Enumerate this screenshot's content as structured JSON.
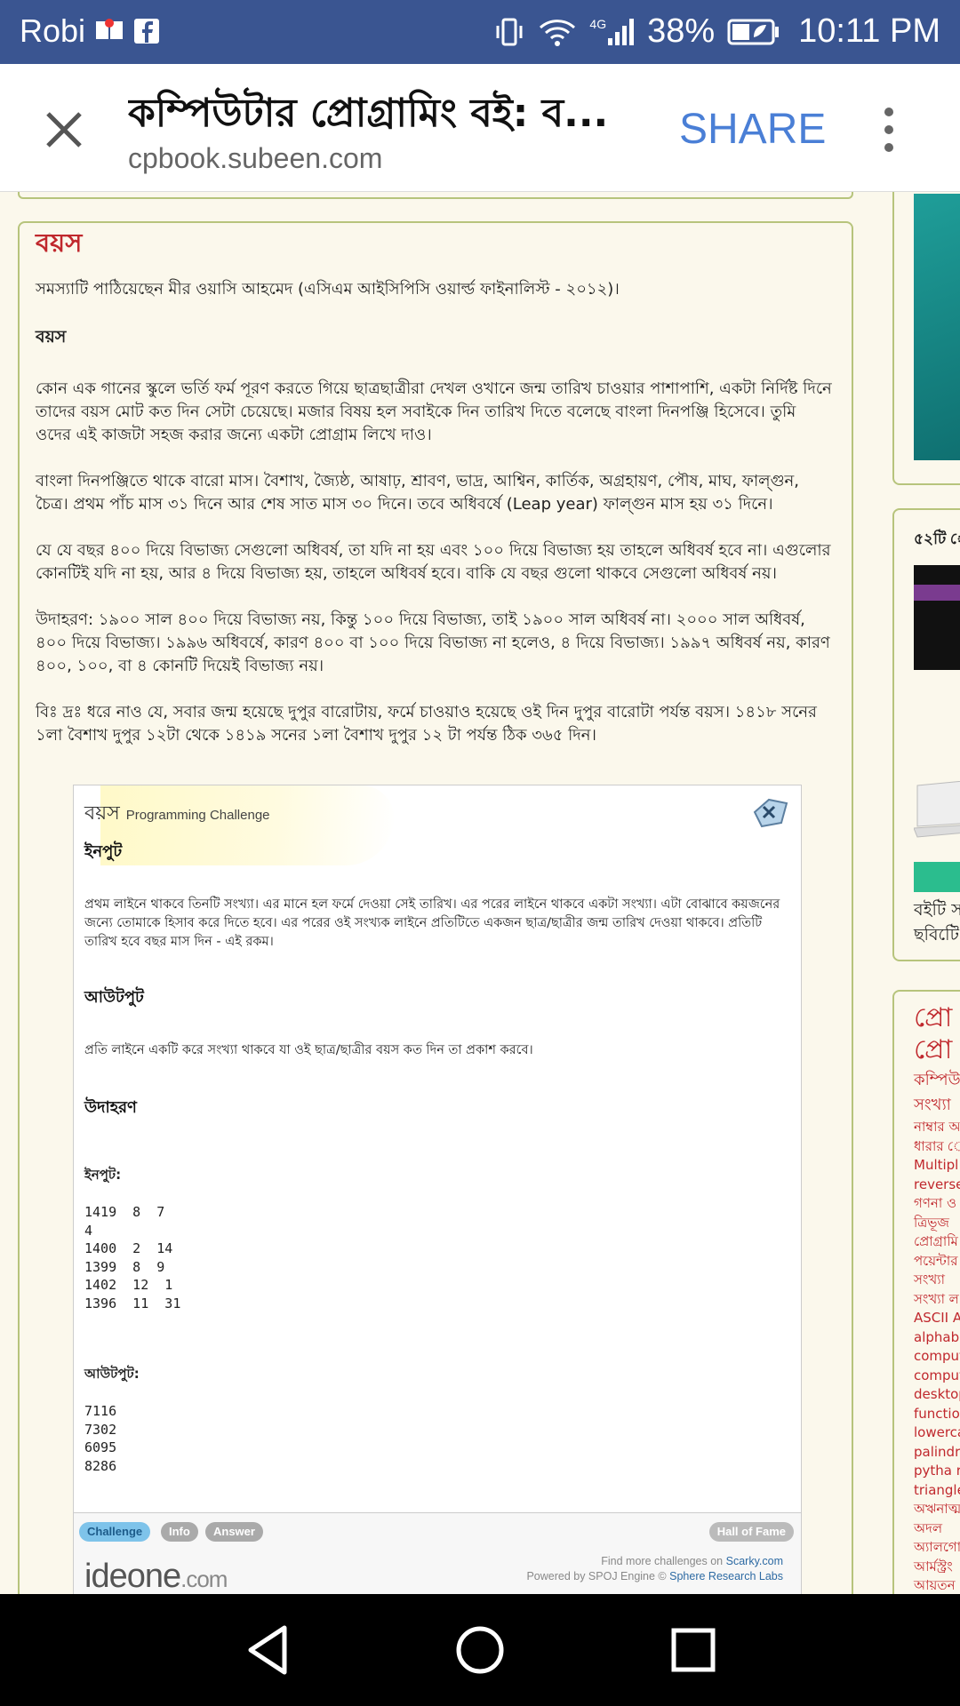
{
  "status_bar": {
    "carrier": "Robi",
    "battery": "38%",
    "network": "4G",
    "time": "10:11 PM"
  },
  "toolbar": {
    "title": "কম্পিউটার প্রোগ্রামিং বই: ব...",
    "url": "cpbook.subeen.com",
    "share": "SHARE"
  },
  "article": {
    "title": "বয়স",
    "intro": "সমস্যাটি পাঠিয়েছেন মীর ওয়াসি আহমেদ (এসিএম আইসিপিসি ওয়ার্ল্ড ফাইনালিস্ট - ২০১২)।",
    "subtitle": "বয়স",
    "p1": "কোন এক গানের স্কুলে ভর্তি ফর্ম পূরণ করতে গিয়ে ছাত্রছাত্রীরা দেখল ওখানে জন্ম তারিখ চাওয়ার পাশাপাশি, একটা নির্দিষ্ট দিনে তাদের বয়স মোট কত দিন সেটা চেয়েছে। মজার বিষয় হল সবাইকে দিন তারিখ দিতে বলেছে বাংলা দিনপঞ্জি হিসেবে। তুমি ওদের এই কাজটা সহজ করার জন্যে একটা প্রোগ্রাম লিখে দাও।",
    "p2": "বাংলা দিনপঞ্জিতে থাকে বারো মাস। বৈশাখ, জ্যৈষ্ঠ, আষাঢ়, শ্রাবণ, ভাদ্র, আশ্বিন, কার্তিক, অগ্রহায়ণ, পৌষ, মাঘ, ফাল্গুন, চৈত্র। প্রথম পাঁচ মাস ৩১ দিনে আর শেষ সাত মাস ৩০ দিনে। তবে অধিবর্ষে (Leap year) ফাল্গুন মাস হয় ৩১ দিনে।",
    "p3": "যে যে বছর ৪০০ দিয়ে বিভাজ্য সেগুলো অধিবর্ষ, তা যদি না হয় এবং ১০০ দিয়ে বিভাজ্য হয় তাহলে অধিবর্ষ হবে না। এগুলোর কোনটিই যদি না হয়, আর ৪ দিয়ে বিভাজ্য হয়, তাহলে অধিবর্ষ হবে। বাকি যে বছর গুলো থাকবে সেগুলো অধিবর্ষ নয়।",
    "p4": "উদাহরণ: ১৯০০ সাল ৪০০ দিয়ে বিভাজ্য নয়, কিন্তু ১০০ দিয়ে বিভাজ্য, তাই ১৯০০ সাল অধিবর্ষ না। ২০০০ সাল অধিবর্ষ, ৪০০ দিয়ে বিভাজ্য। ১৯৯৬ অধিবর্ষে, কারণ ৪০০ বা ১০০ দিয়ে বিভাজ্য না হলেও, ৪ দিয়ে বিভাজ্য। ১৯৯৭ অধিবর্ষ নয়, কারণ ৪০০, ১০০, বা ৪ কোনটি দিয়েই বিভাজ্য নয়।",
    "p5": "বিঃ দ্রঃ ধরে নাও যে, সবার জন্ম হয়েছে দুপুর বারোটায়, ফর্মে চাওয়াও হয়েছে ওই দিন দুপুর বারোটা পর্যন্ত বয়স। ১৪১৮ সনের ১লা বৈশাখ দুপুর ১২টা থেকে ১৪১৯ সনের ১লা বৈশাখ দুপুর ১২ টা পর্যন্ত ঠিক ৩৬৫ দিন।"
  },
  "ideone": {
    "title": "বয়স",
    "title_suffix": "Programming Challenge",
    "input_heading": "ইনপুট",
    "input_text": "প্রথম লাইনে থাকবে তিনটি সংখ্যা। এর মানে হল ফর্মে দেওয়া সেই তারিখ। এর পরের লাইনে থাকবে একটা সংখ্যা। এটা বোঝাবে কয়জনের জন্যে তোমাকে হিসাব করে দিতে হবে। এর পরের ওই সংখ্যক লাইনে প্রতিটিতে একজন ছাত্র/ছাত্রীর জন্ম তারিখ দেওয়া থাকবে। প্রতিটি তারিখ হবে বছর মাস দিন - এই রকম।",
    "output_heading": "আউটপুট",
    "output_text": "প্রতি লাইনে একটি করে সংখ্যা থাকবে যা ওই ছাত্র/ছাত্রীর বয়স কত দিন তা প্রকাশ করবে।",
    "example_heading": "উদাহরণ",
    "sample_input_label": "ইনপুট:",
    "sample_input": "1419  8  7\n4\n1400  2  14\n1399  8  9\n1402  12  1\n1396  11  31",
    "sample_output_label": "আউটপুট:",
    "sample_output": "7116\n7302\n6095\n8286",
    "tabs": [
      "Challenge",
      "Info",
      "Answer"
    ],
    "hall_of_fame": "Hall of Fame",
    "logo": "ideone",
    "logo_suffix": ".com",
    "credit_line1": "Find more challenges on",
    "credit_link1": "Scarky.com",
    "credit_line2": "Powered by SPOJ Engine ©",
    "credit_link2": "Sphere Research Labs"
  },
  "sidebar": {
    "box2_heading": "৫২টি ে",
    "box2_line1": "বইটি স",
    "box2_line2": "ছবিটিে",
    "box3_heading1": "প্রো",
    "box3_heading2": "প্রো",
    "tags": [
      "কম্পিউ",
      "সংখ্যা",
      "নাম্বার আ",
      "ধারার ে",
      "Multipl",
      "reverse",
      "গণনা ও",
      "ত্রিভূজ",
      "প্রোগ্রামি",
      "পয়েন্টার",
      "সংখ্যা",
      "সংখ্যা ল",
      "ASCII  A",
      "alphabe",
      "comput",
      "comput",
      "desktop",
      "function",
      "lowerca",
      "palindro",
      "pytha  r",
      "triangle",
      "অঋনাত্মক",
      "অদল",
      "অ্যালগো",
      "আর্মস্ট্রং",
      "আয়তন"
    ]
  },
  "colors": {
    "accent_red": "#c0282d",
    "link_blue": "#4a7fd6",
    "status_bar": "#3a5591",
    "border_green": "#b7c47c"
  }
}
